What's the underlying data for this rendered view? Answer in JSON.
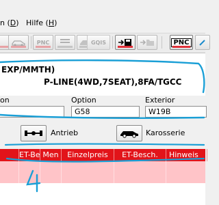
{
  "menu": {
    "first_label": "n",
    "first_key": "D",
    "help_label": "Hilfe",
    "help_key": "H"
  },
  "toolbar": {
    "pnc_small": "PNC",
    "gqis": "GQIS",
    "pnc_active": "PNC"
  },
  "vehicle": {
    "line1": "EXP/MMTH)",
    "line2": "P-LINE(4WD,7SEAT),8FA/T",
    "market": "GCC"
  },
  "fields": {
    "left_label": "on",
    "left_value": "",
    "option_label": "Option",
    "option_value": "G58",
    "exterior_label": "Exterior",
    "exterior_value": "W19B"
  },
  "filters": {
    "drive_label": "Antrieb",
    "body_label": "Karosserie"
  },
  "grid": {
    "columns": [
      "ET-Bez.",
      "Men",
      "Einzelpreis",
      "ET-Besch.",
      "Hinweis"
    ]
  },
  "annotation": {
    "handwritten_number": "4"
  },
  "colors": {
    "grid_header": "#e2141a",
    "grid_row": "#ffc4c8",
    "annotation_pen": "#1a9fd6"
  }
}
